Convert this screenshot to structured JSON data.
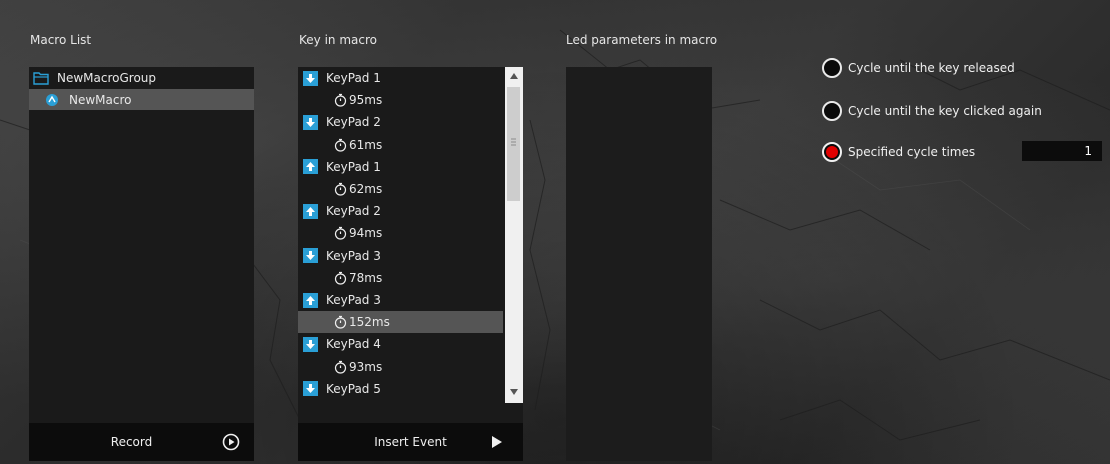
{
  "sections": {
    "macro_list": "Macro List",
    "key_in_macro": "Key in macro",
    "led_params": "Led parameters in macro"
  },
  "macro_tree": {
    "group": "NewMacroGroup",
    "macro": "NewMacro"
  },
  "key_events": [
    {
      "type": "key",
      "direction": "down",
      "label": "KeyPad 1"
    },
    {
      "type": "delay",
      "label": "95ms"
    },
    {
      "type": "key",
      "direction": "down",
      "label": "KeyPad 2"
    },
    {
      "type": "delay",
      "label": "61ms"
    },
    {
      "type": "key",
      "direction": "up",
      "label": "KeyPad 1"
    },
    {
      "type": "delay",
      "label": "62ms"
    },
    {
      "type": "key",
      "direction": "up",
      "label": "KeyPad 2"
    },
    {
      "type": "delay",
      "label": "94ms"
    },
    {
      "type": "key",
      "direction": "down",
      "label": "KeyPad 3"
    },
    {
      "type": "delay",
      "label": "78ms"
    },
    {
      "type": "key",
      "direction": "up",
      "label": "KeyPad 3"
    },
    {
      "type": "delay",
      "label": "152ms",
      "selected": true
    },
    {
      "type": "key",
      "direction": "down",
      "label": "KeyPad 4"
    },
    {
      "type": "delay",
      "label": "93ms"
    },
    {
      "type": "key",
      "direction": "down",
      "label": "KeyPad 5"
    }
  ],
  "footers": {
    "record": "Record",
    "insert_event": "Insert Event"
  },
  "cycle_options": {
    "until_released": "Cycle until the key released",
    "until_clicked_again": "Cycle until the key clicked again",
    "specified_times": "Specified cycle times",
    "selected": "specified_times",
    "cycle_count": "1"
  },
  "colors": {
    "accent_blue": "#2a9fd6",
    "radio_selected": "#e00000"
  }
}
